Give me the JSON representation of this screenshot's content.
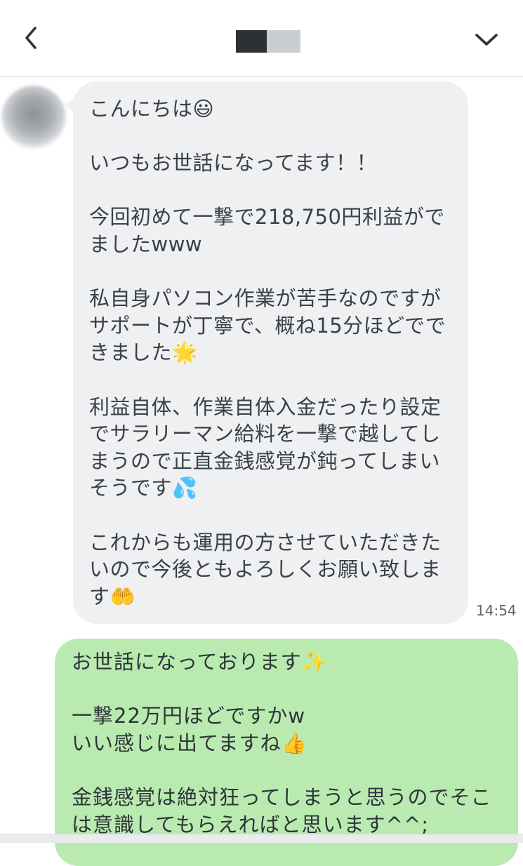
{
  "header": {
    "back_icon": "chevron-left-icon",
    "menu_icon": "chevron-down-icon",
    "title": "",
    "colors": {
      "redaction_dark": "#2d3035",
      "redaction_light": "#c9cfd0"
    }
  },
  "messages": [
    {
      "direction": "incoming",
      "sender": "",
      "text": "こんにちは😃\n\nいつもお世話になってます！！\n\n今回初めて一撃で218,750円利益がでましたwww\n\n私自身パソコン作業が苦手なのですがサポートが丁寧で、概ね15分ほどでできました🌟\n\n利益自体、作業自体入金だったり設定でサラリーマン給料を一撃で越してしまうので正直金銭感覚が鈍ってしまいそうです💦\n\nこれからも運用の方させていただきたいので今後ともよろしくお願い致します🤲",
      "time": "14:54",
      "bubble_color": "#eff0f2"
    },
    {
      "direction": "outgoing",
      "text": "お世話になっております✨\n\n一撃22万円ほどですかw\nいい感じに出てますね👍\n\n金銭感覚は絶対狂ってしまうと思うのでそこは意識してもらえればと思います^^;",
      "bubble_color": "#b9ebb0"
    }
  ]
}
